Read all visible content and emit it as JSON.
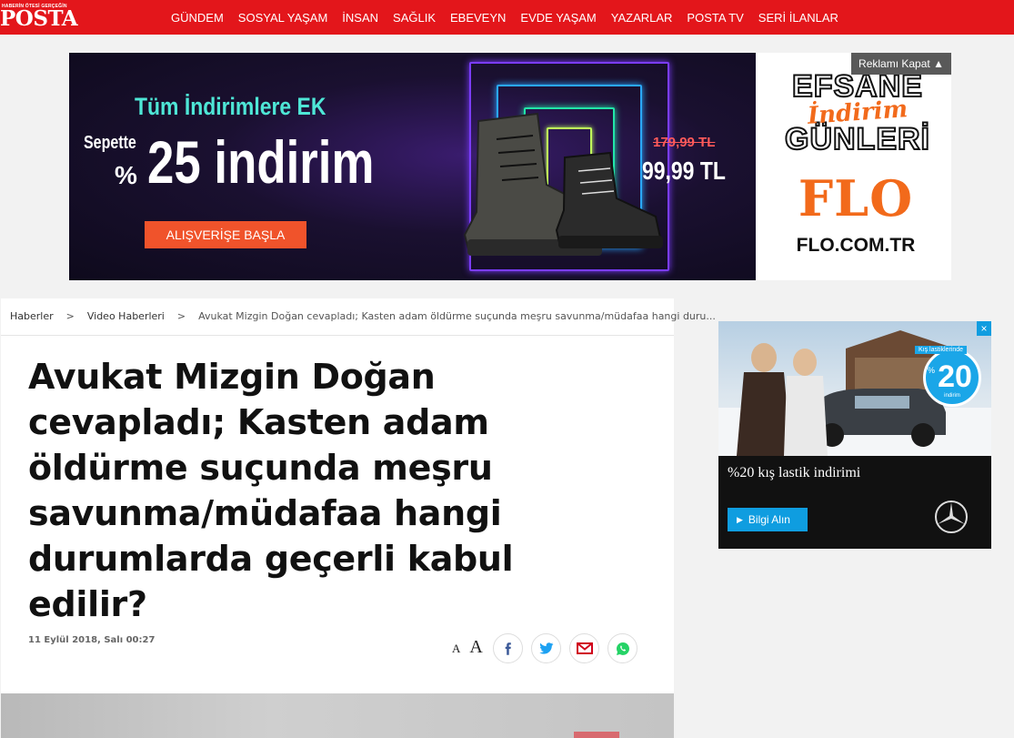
{
  "brand": {
    "logo_text": "POSTA",
    "logo_tagline": "HABERİN ÖTESİ GERÇEĞİN"
  },
  "nav": {
    "items": [
      "GÜNDEM",
      "SOSYAL YAŞAM",
      "İNSAN",
      "SAĞLIK",
      "EBEVEYN",
      "EVDE YAŞAM",
      "YAZARLAR",
      "POSTA TV",
      "SERİ İLANLAR"
    ]
  },
  "banner_ad": {
    "close_label": "Reklamı Kapat ▲",
    "headline": "Tüm İndirimlere EK",
    "sepette": "Sepette",
    "percent": "%",
    "discount": "25 indirim",
    "cta": "ALIŞVERİŞE BAŞLA",
    "old_price": "179,99 TL",
    "new_price": "99,99 TL",
    "campaign_line1": "EFSANE",
    "campaign_line2": "İndirim",
    "campaign_line3": "GÜNLERİ",
    "brand": "FLO",
    "url": "FLO.COM.TR",
    "colors": {
      "accent": "#f26a1b",
      "cta": "#f0532b",
      "headline": "#4ee6d6",
      "old_price": "#ff5a5a"
    }
  },
  "breadcrumb": {
    "items": [
      "Haberler",
      "Video Haberleri",
      "Avukat Mizgin Doğan cevapladı; Kasten adam öldürme suçunda meşru savunma/müdafaa hangi duru..."
    ],
    "separator": ">"
  },
  "article": {
    "title": "Avukat Mizgin Doğan cevapladı; Kasten adam öldürme suçunda meşru savunma/müdafaa hangi durumlarda geçerli kabul edilir?",
    "date": "11 Eylül 2018, Salı 00:27",
    "font_small": "A",
    "font_large": "A",
    "share_icons": [
      "facebook-icon",
      "twitter-icon",
      "mail-icon",
      "whatsapp-icon"
    ]
  },
  "side_ad": {
    "close_icon": "×",
    "badge_top": "Kış lastiklerinde",
    "badge_percent": "%",
    "badge_value": "20",
    "badge_sub": "indirim",
    "text": "%20 kış lastik indirimi",
    "button": "Bilgi Alın",
    "logo": "mercedes-logo-icon",
    "colors": {
      "accent": "#0f9de0"
    }
  },
  "colors": {
    "brand_red": "#e3161b",
    "page_bg": "#f2f2f2"
  }
}
